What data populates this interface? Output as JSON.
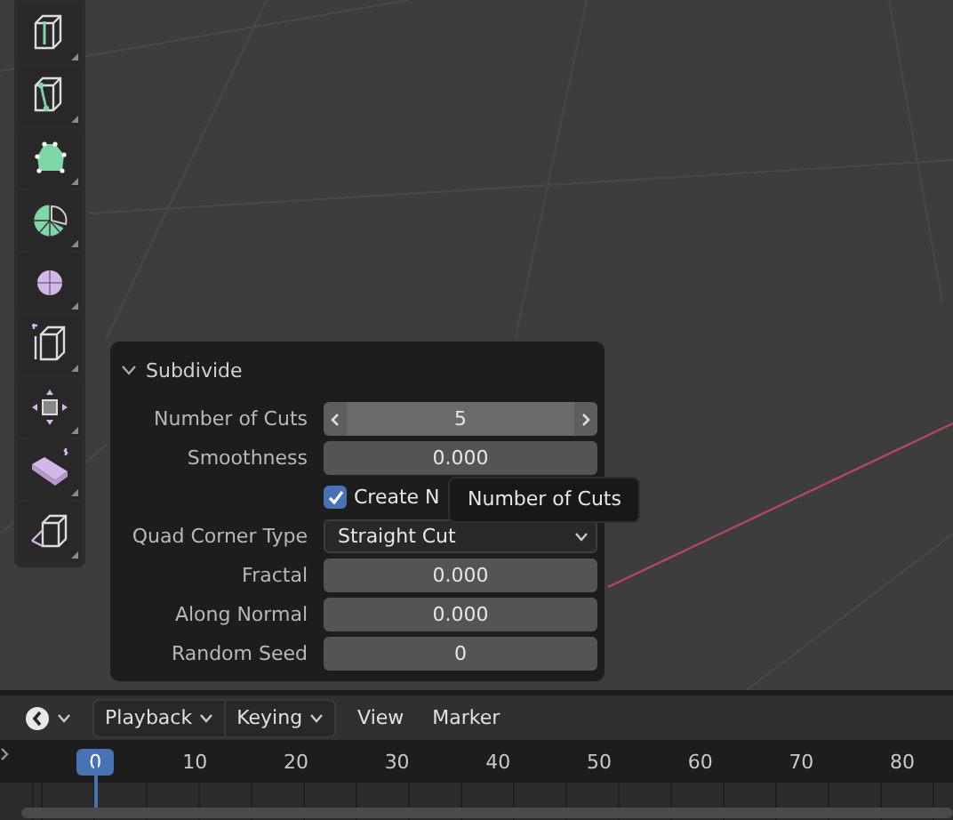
{
  "panel": {
    "title": "Subdivide",
    "expanded": true,
    "fields": [
      {
        "kind": "stepper",
        "label": "Number of Cuts",
        "value": "5"
      },
      {
        "kind": "number",
        "label": "Smoothness",
        "value": "0.000"
      },
      {
        "kind": "checkbox",
        "label": "Create N",
        "checked": true
      },
      {
        "kind": "dropdown",
        "label": "Quad Corner Type",
        "value": "Straight Cut"
      },
      {
        "kind": "number",
        "label": "Fractal",
        "value": "0.000"
      },
      {
        "kind": "number",
        "label": "Along Normal",
        "value": "0.000"
      },
      {
        "kind": "number",
        "label": "Random Seed",
        "value": "0"
      }
    ]
  },
  "tooltip": {
    "text": "Number of Cuts"
  },
  "timeline": {
    "menus": [
      {
        "kind": "dropdown",
        "label": "Playback"
      },
      {
        "kind": "dropdown",
        "label": "Keying"
      },
      {
        "kind": "plain",
        "label": "View"
      },
      {
        "kind": "plain",
        "label": "Marker"
      }
    ],
    "current_frame": "0",
    "ticks": [
      "10",
      "20",
      "30",
      "40",
      "50",
      "60",
      "70",
      "80"
    ]
  }
}
